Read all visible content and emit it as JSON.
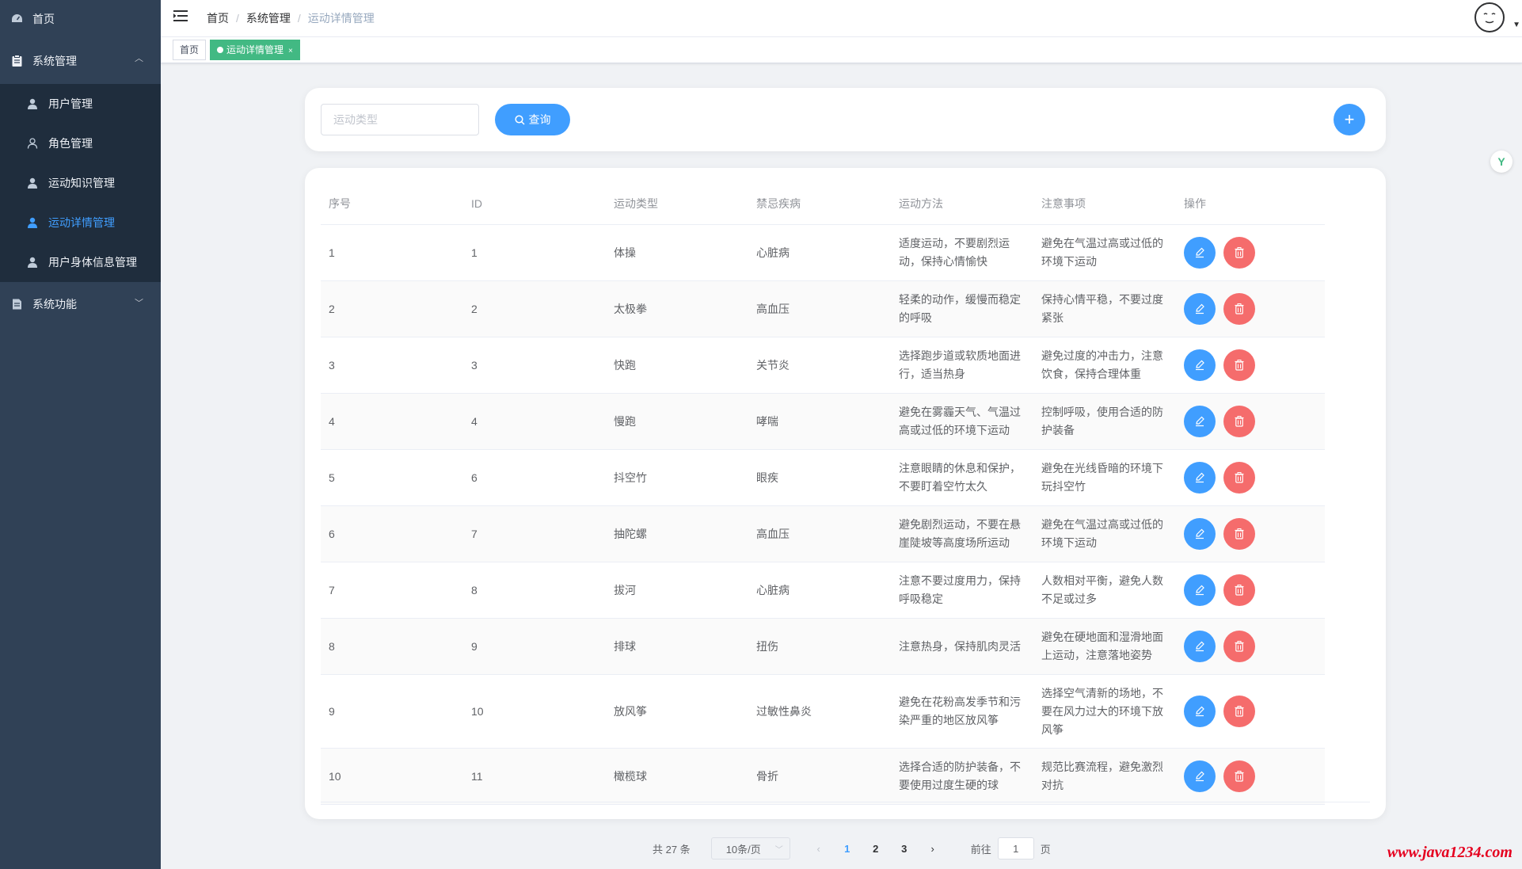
{
  "sidebar": {
    "home": "首页",
    "system_mgmt": "系统管理",
    "sub_items": [
      "用户管理",
      "角色管理",
      "运动知识管理",
      "运动详情管理",
      "用户身体信息管理"
    ],
    "system_func": "系统功能",
    "active_index": 3
  },
  "header": {
    "breadcrumb": [
      "首页",
      "系统管理",
      "运动详情管理"
    ]
  },
  "tags": {
    "home": "首页",
    "active": "运动详情管理"
  },
  "search": {
    "placeholder": "运动类型",
    "button": "查询"
  },
  "table": {
    "columns": [
      "序号",
      "ID",
      "运动类型",
      "禁忌疾病",
      "运动方法",
      "注意事项",
      "操作"
    ],
    "rows": [
      {
        "no": "1",
        "id": "1",
        "type": "体操",
        "disease": "心脏病",
        "method": "适度运动，不要剧烈运动，保持心情愉快",
        "note": "避免在气温过高或过低的环境下运动"
      },
      {
        "no": "2",
        "id": "2",
        "type": "太极拳",
        "disease": "高血压",
        "method": "轻柔的动作，缓慢而稳定的呼吸",
        "note": "保持心情平稳，不要过度紧张"
      },
      {
        "no": "3",
        "id": "3",
        "type": "快跑",
        "disease": "关节炎",
        "method": "选择跑步道或软质地面进行，适当热身",
        "note": "避免过度的冲击力，注意饮食，保持合理体重"
      },
      {
        "no": "4",
        "id": "4",
        "type": "慢跑",
        "disease": "哮喘",
        "method": "避免在雾霾天气、气温过高或过低的环境下运动",
        "note": "控制呼吸，使用合适的防护装备"
      },
      {
        "no": "5",
        "id": "6",
        "type": "抖空竹",
        "disease": "眼疾",
        "method": "注意眼睛的休息和保护，不要盯着空竹太久",
        "note": "避免在光线昏暗的环境下玩抖空竹"
      },
      {
        "no": "6",
        "id": "7",
        "type": "抽陀螺",
        "disease": "高血压",
        "method": "避免剧烈运动，不要在悬崖陡坡等高度场所运动",
        "note": "避免在气温过高或过低的环境下运动"
      },
      {
        "no": "7",
        "id": "8",
        "type": "拔河",
        "disease": "心脏病",
        "method": "注意不要过度用力，保持呼吸稳定",
        "note": "人数相对平衡，避免人数不足或过多"
      },
      {
        "no": "8",
        "id": "9",
        "type": "排球",
        "disease": "扭伤",
        "method": "注意热身，保持肌肉灵活",
        "note": "避免在硬地面和湿滑地面上运动，注意落地姿势"
      },
      {
        "no": "9",
        "id": "10",
        "type": "放风筝",
        "disease": "过敏性鼻炎",
        "method": "避免在花粉高发季节和污染严重的地区放风筝",
        "note": "选择空气清新的场地，不要在风力过大的环境下放风筝"
      },
      {
        "no": "10",
        "id": "11",
        "type": "橄榄球",
        "disease": "骨折",
        "method": "选择合适的防护装备，不要使用过度生硬的球",
        "note": "规范比赛流程，避免激烈对抗"
      }
    ]
  },
  "pagination": {
    "total": "共 27 条",
    "page_size": "10条/页",
    "pages": [
      "1",
      "2",
      "3"
    ],
    "current": "1",
    "goto_label": "前往",
    "goto_value": "1",
    "page_suffix": "页"
  },
  "watermark": "www.java1234.com",
  "widget_label": "Y",
  "colors": {
    "sidebar": "#304156",
    "primary": "#409eff",
    "danger": "#f56c6c",
    "tag_active": "#42b983"
  },
  "icons": [
    "dashboard-icon",
    "clipboard-icon",
    "user-icon",
    "user-outline-icon",
    "document-icon",
    "search-icon",
    "plus-icon",
    "edit-icon",
    "delete-icon",
    "hamburger-icon"
  ]
}
